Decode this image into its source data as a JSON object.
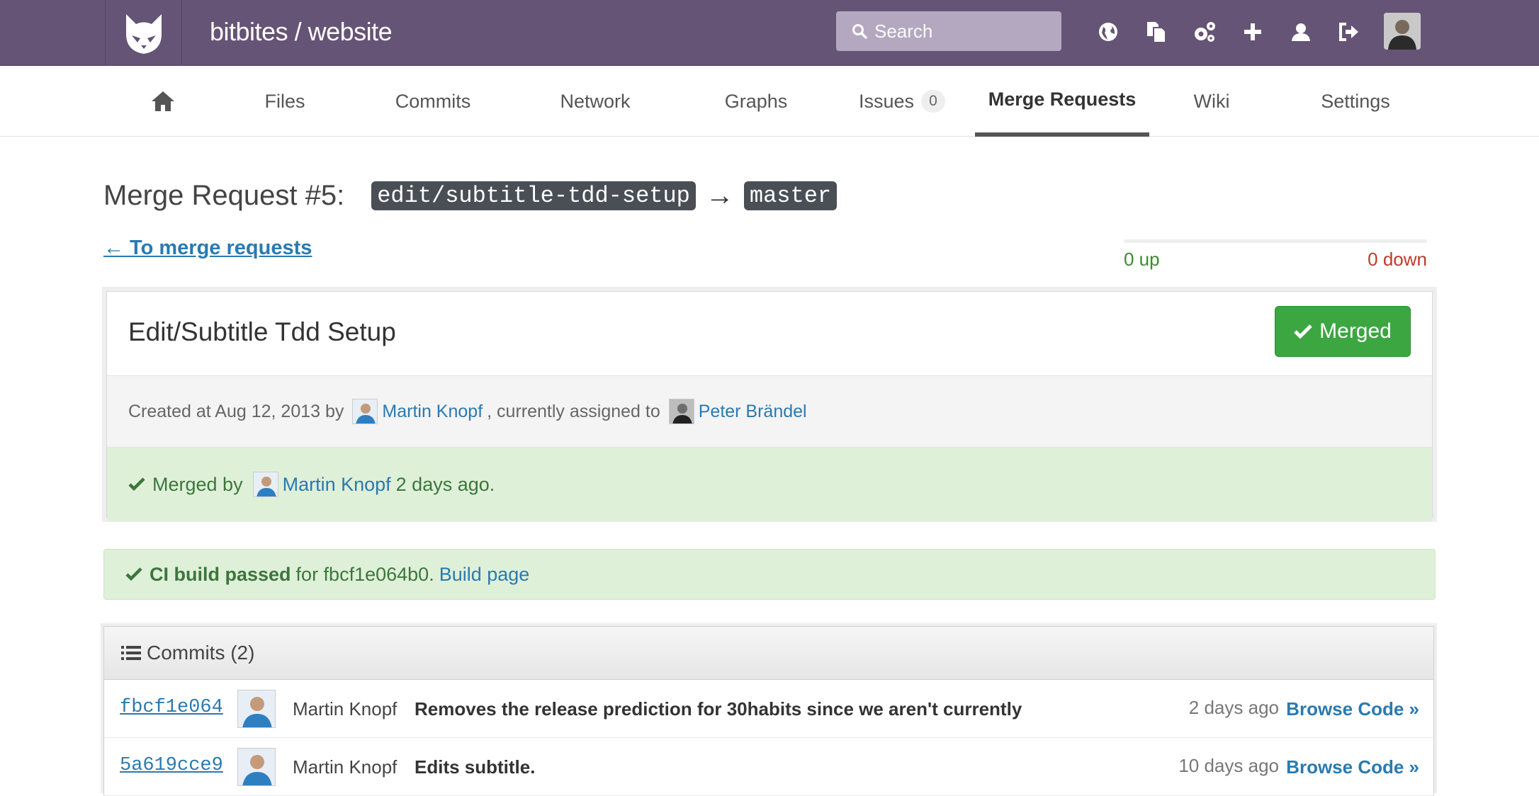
{
  "header": {
    "project_title": "bitbites / website",
    "search_placeholder": "Search",
    "icons": [
      "globe-icon",
      "copy-icon",
      "cogs-icon",
      "plus-icon",
      "user-icon",
      "sign-out-icon"
    ]
  },
  "nav": {
    "home_icon": "home-icon",
    "items": [
      {
        "label": "Files"
      },
      {
        "label": "Commits"
      },
      {
        "label": "Network"
      },
      {
        "label": "Graphs"
      },
      {
        "label": "Issues",
        "count": "0"
      },
      {
        "label": "Merge Requests",
        "active": true
      },
      {
        "label": "Wiki"
      },
      {
        "label": "Settings"
      }
    ]
  },
  "merge_request": {
    "heading": "Merge Request #5:",
    "source_branch": "edit/subtitle-tdd-setup",
    "arrow": "→",
    "target_branch": "master",
    "back_link": "← To merge requests",
    "votes": {
      "up": "0 up",
      "down": "0 down"
    },
    "title": "Edit/Subtitle Tdd Setup",
    "status_button": "Merged",
    "created_text": "Created at Aug 12, 2013 by",
    "author": "Martin Knopf",
    "assigned_text": ", currently assigned to",
    "assignee": "Peter Brändel",
    "merged_by_text": "Merged by",
    "merged_by": "Martin Knopf",
    "merged_when": "2 days ago."
  },
  "ci": {
    "status": "CI build passed",
    "for_text": "for fbcf1e064b0.",
    "build_link": "Build page"
  },
  "commits": {
    "header": "Commits (2)",
    "rows": [
      {
        "sha": "fbcf1e064",
        "author": "Martin Knopf",
        "message": "Removes the release prediction for 30habits since we aren't currently",
        "time": "2 days ago",
        "browse": "Browse Code »"
      },
      {
        "sha": "5a619cce9",
        "author": "Martin Knopf",
        "message": "Edits subtitle.",
        "time": "10 days ago",
        "browse": "Browse Code »"
      }
    ]
  },
  "colors": {
    "header_bg": "#655475",
    "link": "#2a7ab0",
    "success_bg": "#dff0d8",
    "merged_button": "#3ca641"
  }
}
